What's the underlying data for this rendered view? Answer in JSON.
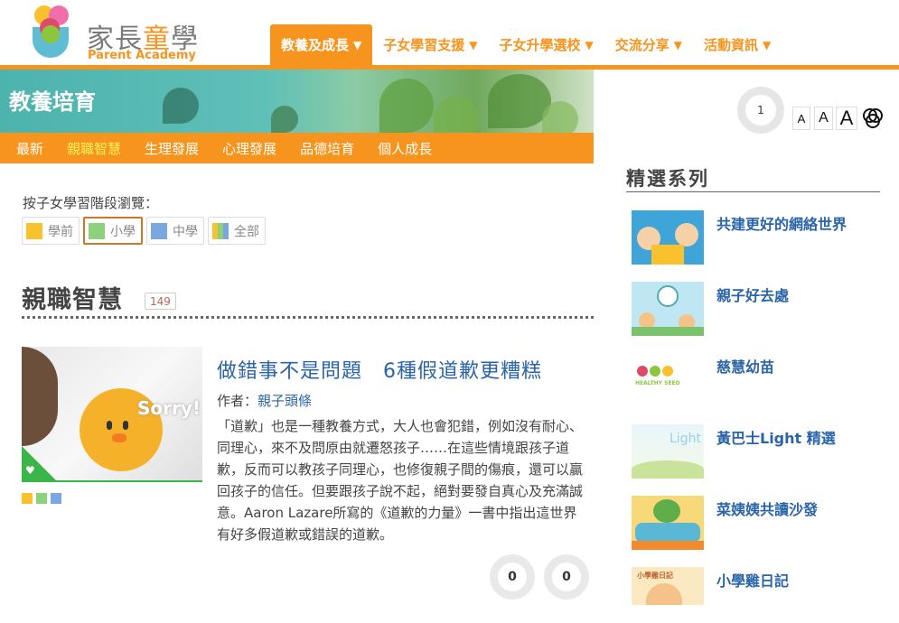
{
  "logo": {
    "zh_a": "家長",
    "zh_b": "童",
    "zh_c": "學",
    "en": "Parent Academy"
  },
  "nav": [
    {
      "label": "教養及成長",
      "caret": "▼"
    },
    {
      "label": "子女學習支援",
      "caret": "▼"
    },
    {
      "label": "子女升學選校",
      "caret": "▼"
    },
    {
      "label": "交流分享",
      "caret": "▼"
    },
    {
      "label": "活動資訊",
      "caret": "▼"
    }
  ],
  "banner": {
    "title": "教養培育"
  },
  "subnav": [
    "最新",
    "親職智慧",
    "生理發展",
    "心理發展",
    "品德培育",
    "個人成長"
  ],
  "filters": {
    "label": "按子女學習階段瀏覽：",
    "chips": [
      {
        "label": "學前",
        "color": "#f9c12e"
      },
      {
        "label": "小學",
        "color": "#8cd27a"
      },
      {
        "label": "中學",
        "color": "#7aa7e0"
      },
      {
        "label": "全部",
        "colors": [
          "#f9c12e",
          "#8cd27a",
          "#7aa7e0"
        ]
      }
    ]
  },
  "section": {
    "title": "親職智慧",
    "count": "149"
  },
  "article": {
    "title": "做錯事不是問題　6種假道歉更糟糕",
    "author_prefix": "作者：",
    "author": "親子頭條",
    "thumb_text": "Sorry!",
    "excerpt": "「道歉」也是一種教養方式，大人也會犯錯，例如沒有耐心、同理心，來不及問原由就遷怒孩子……在這些情境跟孩子道歉，反而可以教孩子同理心，也修復親子間的傷痕，還可以贏回孩子的信任。但要跟孩子說不起，絕對要發自真心及充滿誠意。Aaron Lazare所寫的《道歉的力量》一書中指出這世界有好多假道歉或錯誤的道歉。",
    "likes": "0",
    "comments": "0"
  },
  "tools": {
    "likes": "1",
    "font_small": "A",
    "font_medium": "A",
    "font_large": "A"
  },
  "featured": {
    "title": "精選系列",
    "items": [
      {
        "label": "共建更好的網絡世界"
      },
      {
        "label": "親子好去處"
      },
      {
        "label": "慈慧幼苗",
        "thumb_text": "HEALTHY SEED"
      },
      {
        "label": "黃巴士Light 精選",
        "thumb_text": "Light"
      },
      {
        "label": "菜姨姨共讀沙發"
      },
      {
        "label": "小學雞日記",
        "thumb_text": "小學雞日記"
      }
    ]
  }
}
